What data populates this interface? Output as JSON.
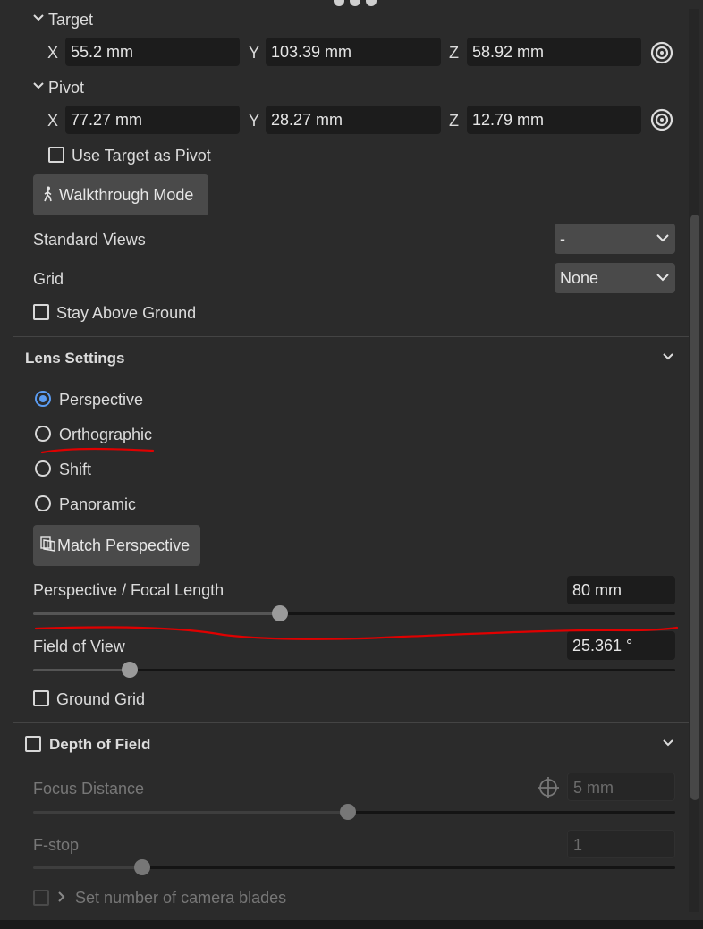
{
  "target": {
    "label": "Target",
    "x_axis": "X",
    "x": "55.2 mm",
    "y_axis": "Y",
    "y": "103.39 mm",
    "z_axis": "Z",
    "z": "58.92 mm"
  },
  "pivot": {
    "label": "Pivot",
    "x_axis": "X",
    "x": "77.27 mm",
    "y_axis": "Y",
    "y": "28.27 mm",
    "z_axis": "Z",
    "z": "12.79 mm"
  },
  "use_target_as_pivot": {
    "label": "Use Target as Pivot",
    "checked": false
  },
  "walkthrough_button": "Walkthrough Mode",
  "standard_views": {
    "label": "Standard Views",
    "value": "-"
  },
  "grid": {
    "label": "Grid",
    "value": "None"
  },
  "stay_above_ground": {
    "label": "Stay Above Ground",
    "checked": false
  },
  "lens_settings": {
    "title": "Lens Settings",
    "options": [
      {
        "label": "Perspective",
        "selected": true
      },
      {
        "label": "Orthographic",
        "selected": false
      },
      {
        "label": "Shift",
        "selected": false
      },
      {
        "label": "Panoramic",
        "selected": false
      }
    ],
    "match_perspective_button": "Match Perspective",
    "focal_length": {
      "label": "Perspective / Focal Length",
      "value": "80 mm",
      "slider_fraction": 0.385
    },
    "field_of_view": {
      "label": "Field of View",
      "value": "25.361 °",
      "slider_fraction": 0.15
    },
    "ground_grid": {
      "label": "Ground Grid",
      "checked": false
    }
  },
  "depth_of_field": {
    "title": "Depth of Field",
    "checked": false,
    "focus_distance": {
      "label": "Focus Distance",
      "value": "5 mm",
      "slider_fraction": 0.49
    },
    "f_stop": {
      "label": "F-stop",
      "value": "1",
      "slider_fraction": 0.17
    },
    "camera_blades": {
      "label": "Set number of camera blades",
      "checked": false
    }
  },
  "colors": {
    "background": "#2b2b2b",
    "field": "#1c1c1c",
    "accent": "#5b9cf2",
    "annotation": "#e00000"
  }
}
